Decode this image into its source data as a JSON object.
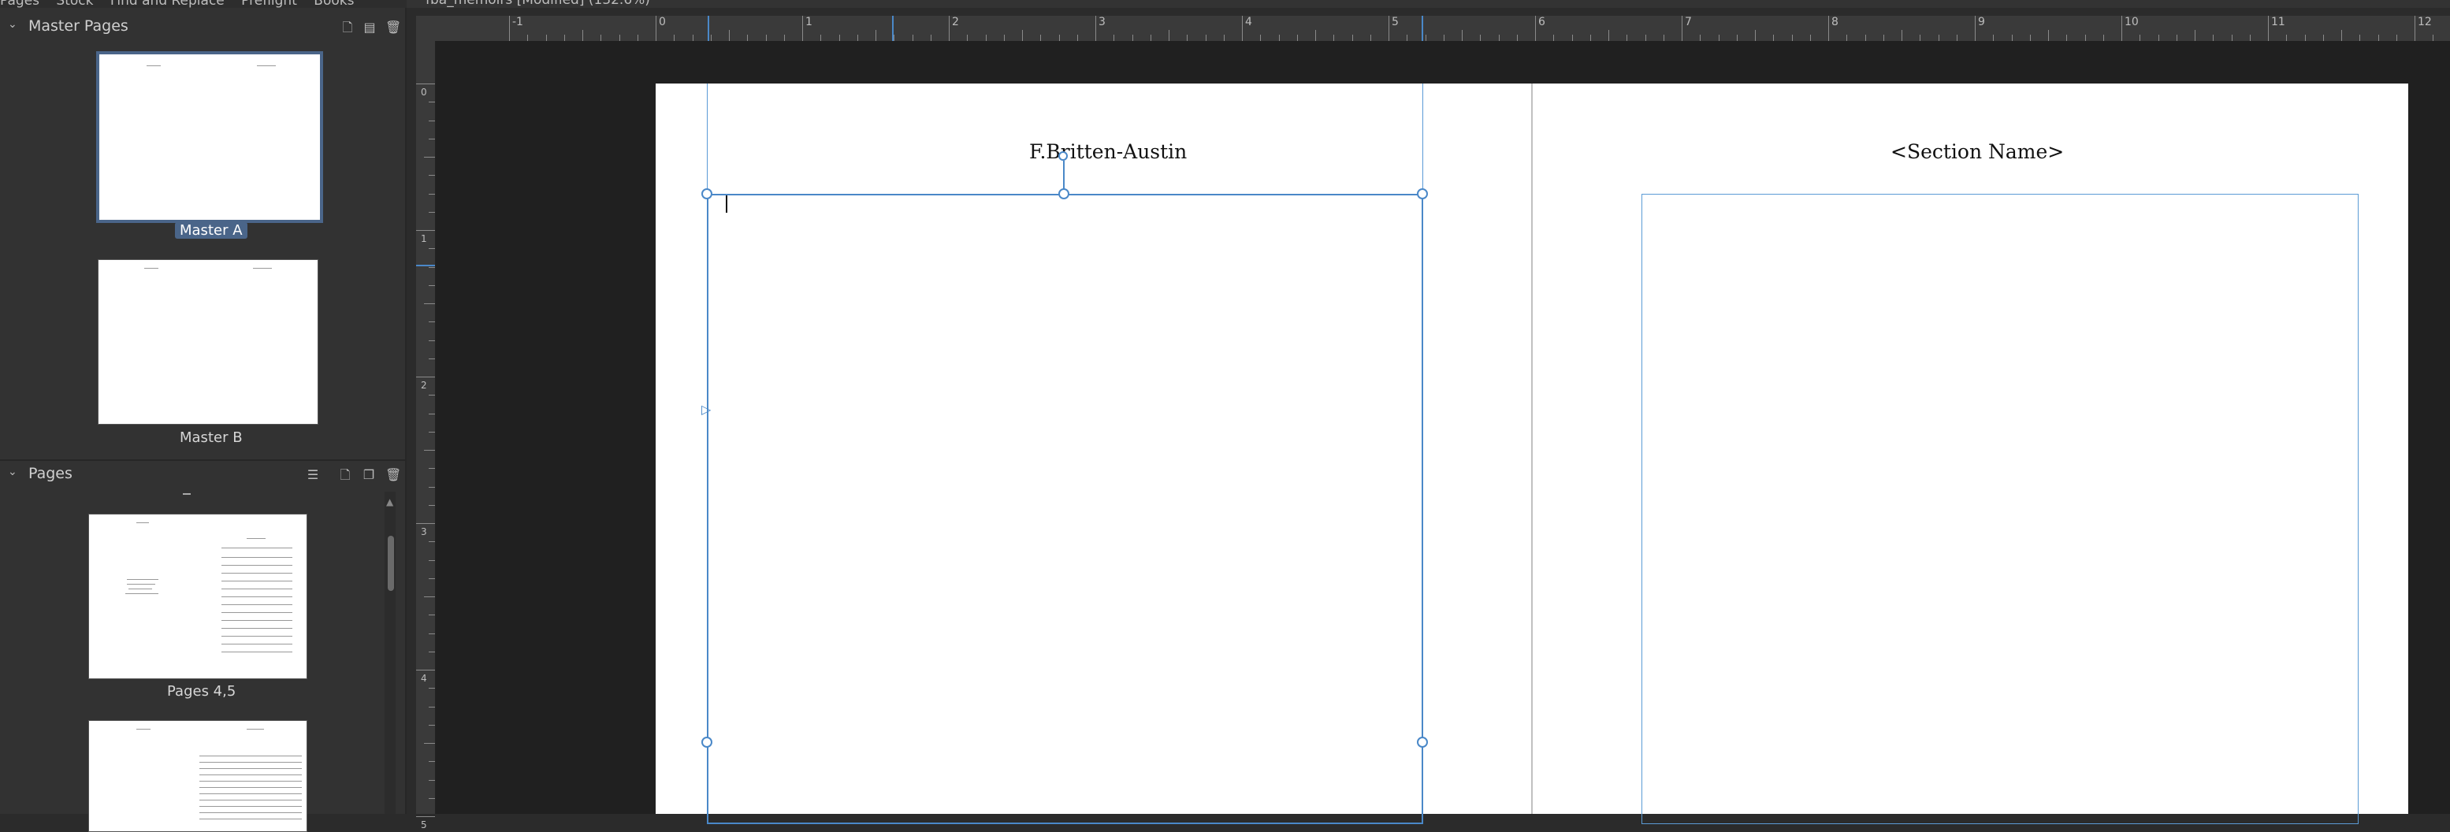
{
  "tabs": [
    "Pages",
    "Stock",
    "Find and Replace",
    "Preflight",
    "Books"
  ],
  "document_title": "fba_memoirs [Modified] (132.6%)",
  "master_pages": {
    "title": "Master Pages",
    "items": [
      {
        "label": "Master A",
        "selected": true
      },
      {
        "label": "Master B",
        "selected": false
      }
    ]
  },
  "pages": {
    "title": "Pages",
    "items": [
      {
        "label": "Pages 4,5"
      },
      {
        "label": ""
      }
    ]
  },
  "ruler": {
    "unit": "in",
    "h_labels": [
      "-1",
      "0",
      "1",
      "2",
      "3",
      "4",
      "5",
      "6",
      "7",
      "8",
      "9",
      "10",
      "11",
      "12"
    ],
    "v_labels": [
      "0",
      "1",
      "2",
      "3",
      "4",
      "5"
    ]
  },
  "spread": {
    "left_header": "F.Britten-Austin",
    "right_header": "<Section Name>"
  },
  "colors": {
    "accent": "#4a88c8",
    "selection": "#4a6589"
  }
}
